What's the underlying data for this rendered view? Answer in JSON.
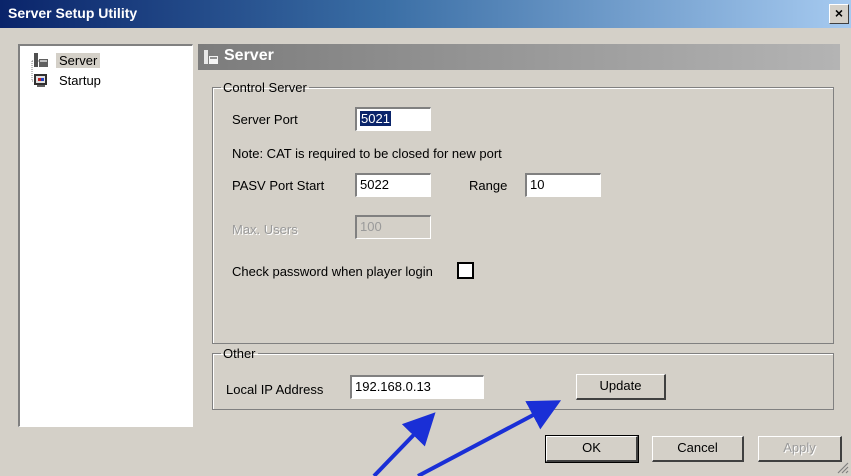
{
  "window": {
    "title": "Server Setup Utility",
    "close_glyph": "×"
  },
  "tree": {
    "items": [
      {
        "label": "Server",
        "icon": "server-icon",
        "selected": true
      },
      {
        "label": "Startup",
        "icon": "startup-icon",
        "selected": false
      }
    ]
  },
  "panel": {
    "title": "Server",
    "icon": "server-icon"
  },
  "control_server": {
    "legend": "Control Server",
    "server_port_label": "Server Port",
    "server_port_value": "5021",
    "note": "Note: CAT is required to be closed  for new port",
    "pasv_label": "PASV Port Start",
    "pasv_value": "5022",
    "range_label": "Range",
    "range_value": "10",
    "max_users_label": "Max. Users",
    "max_users_value": "100",
    "check_password_label": "Check password when player login",
    "check_password_checked": false
  },
  "other": {
    "legend": "Other",
    "local_ip_label": "Local IP Address",
    "local_ip_value": "192.168.0.13",
    "update_label": "Update"
  },
  "buttons": {
    "ok": "OK",
    "cancel": "Cancel",
    "apply": "Apply"
  },
  "colors": {
    "titlebar": "#0a246a",
    "dialog": "#d4d0c8",
    "arrow": "#1a2fd6",
    "header": "#7c7c7c"
  }
}
